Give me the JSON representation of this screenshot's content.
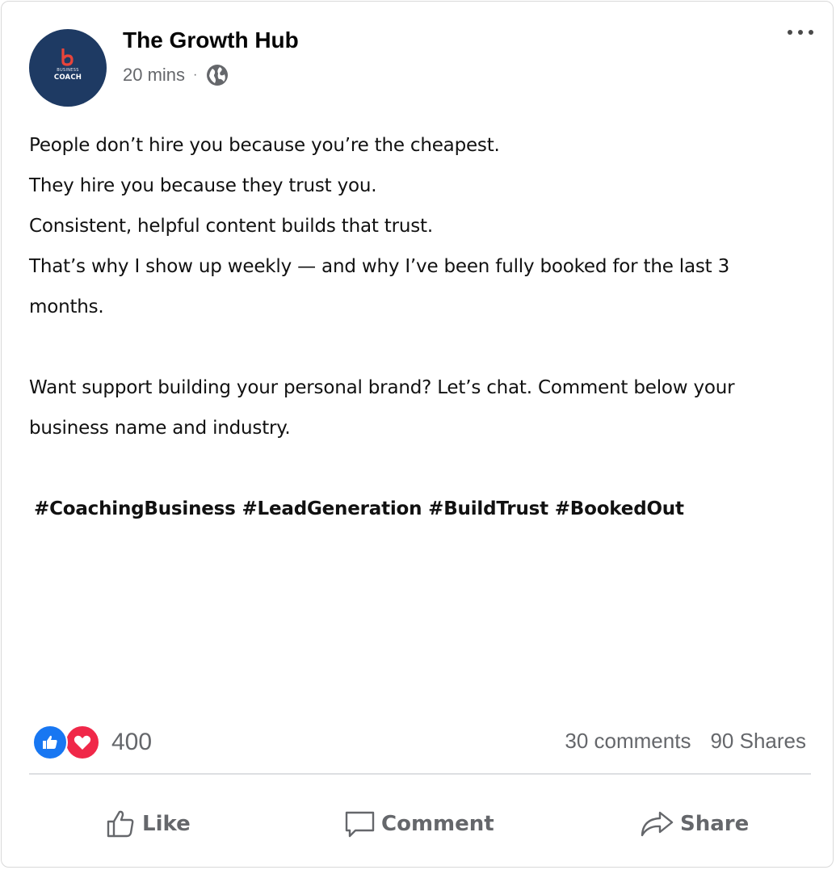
{
  "post": {
    "page_name": "The Growth Hub",
    "time": "20 mins",
    "separator": "·",
    "audience_icon": "globe-icon",
    "avatar": {
      "logo_letter": "b",
      "line1": "BUSINESS",
      "line2": "COACH",
      "bg_color": "#1e3a63",
      "accent_color": "#e8443a"
    },
    "more_icon": "more-horizontal-icon",
    "lines": [
      "People don’t hire you because you’re the cheapest.",
      "They hire you because they trust you.",
      "Consistent, helpful content builds that trust.",
      "That’s why I show up weekly — and why I’ve been fully booked for the last 3",
      "months.",
      "Want support building your personal brand? Let’s chat. Comment below your",
      "business name and industry."
    ],
    "hashtags": "#CoachingBusiness #LeadGeneration #BuildTrust #BookedOut"
  },
  "reactions": {
    "count": "400",
    "types": [
      "like-reaction-icon",
      "love-reaction-icon"
    ],
    "like_color": "#1877f2",
    "love_color": "#f02849"
  },
  "stats": {
    "comments": "30 comments",
    "shares": "90 Shares"
  },
  "actions": {
    "like": "Like",
    "comment": "Comment",
    "share": "Share"
  }
}
